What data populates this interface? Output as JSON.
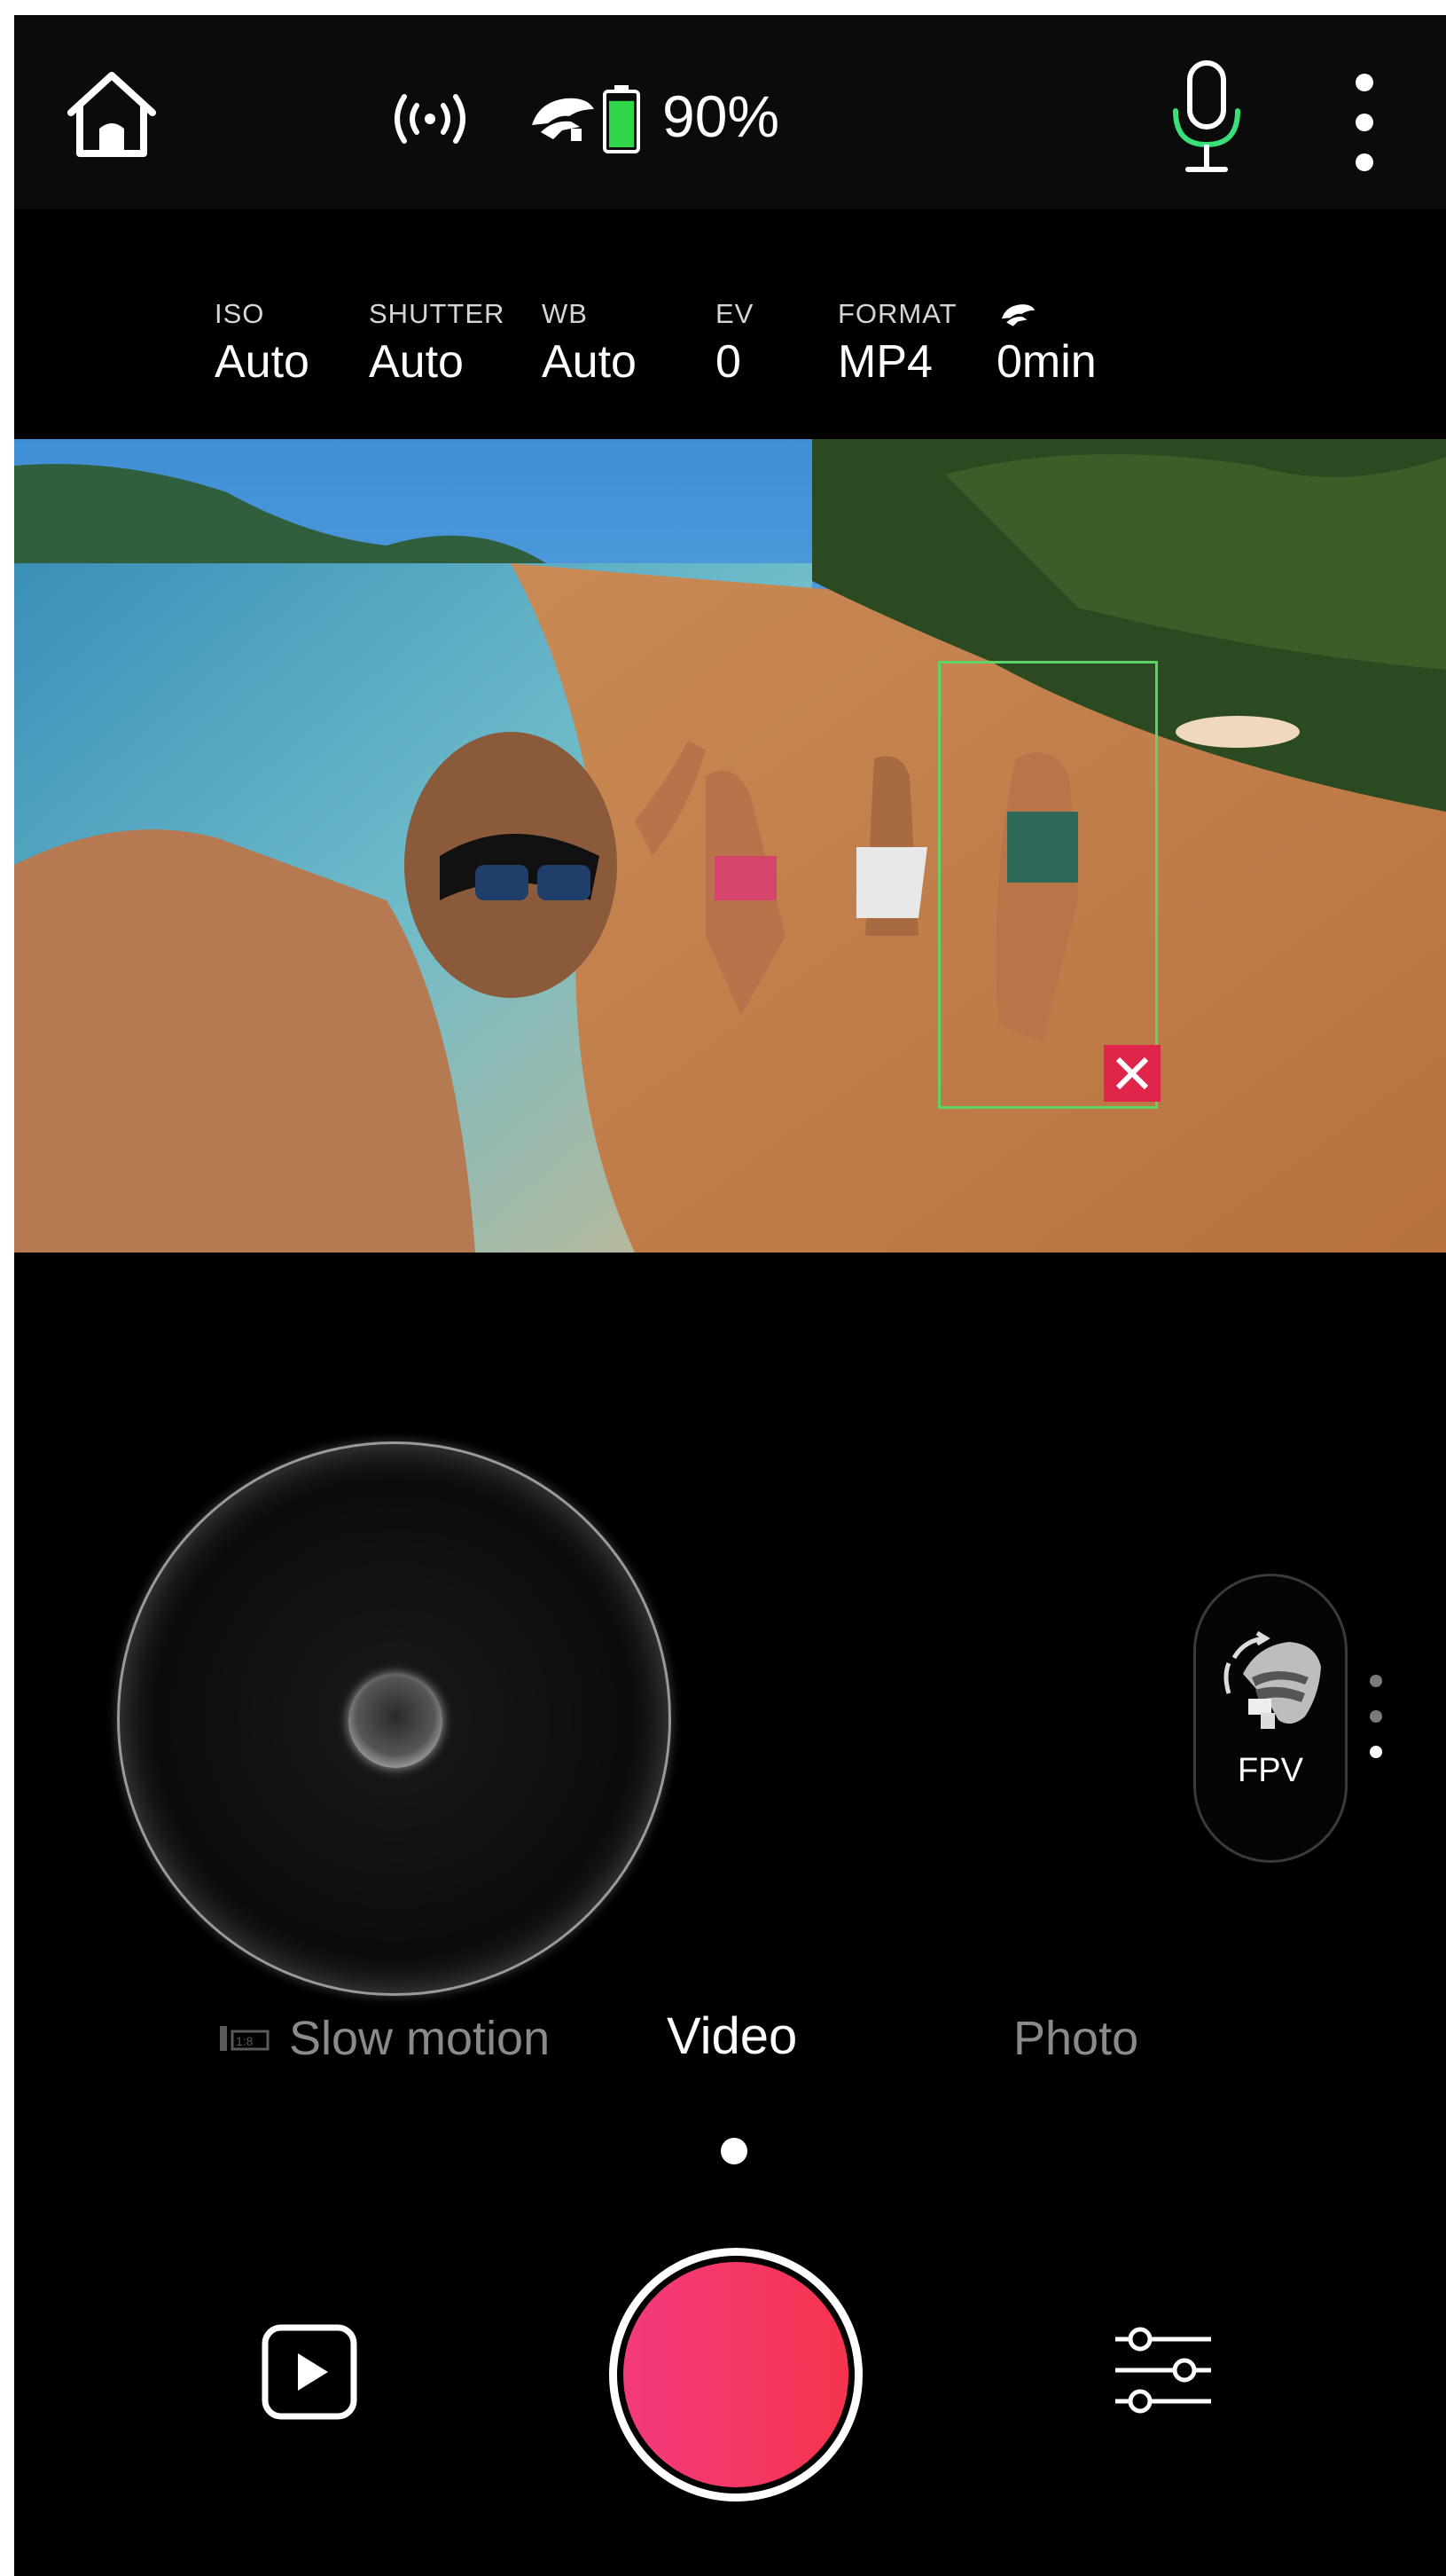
{
  "status": {
    "battery_percent": "90%",
    "battery_level": 0.9,
    "colors": {
      "battery_fill": "#2fd64a",
      "mic_accent": "#39e07a"
    }
  },
  "params": {
    "iso": {
      "label": "ISO",
      "value": "Auto"
    },
    "shutter": {
      "label": "SHUTTER",
      "value": "Auto"
    },
    "wb": {
      "label": "WB",
      "value": "Auto"
    },
    "ev": {
      "label": "EV",
      "value": "0"
    },
    "format": {
      "label": "FORMAT",
      "value": "MP4"
    },
    "remaining": {
      "icon": "gimbal-icon",
      "value": "0min"
    }
  },
  "preview": {
    "tracking_box_color": "#5fd36a",
    "tracking_close_color": "#e0254b"
  },
  "fpv": {
    "label": "FPV"
  },
  "modes": {
    "items": [
      {
        "label": "Slow motion",
        "selected": false
      },
      {
        "label": "Video",
        "selected": true
      },
      {
        "label": "Photo",
        "selected": false
      }
    ]
  },
  "shutter": {
    "colors": {
      "start": "#f33b7d",
      "end": "#f5344e"
    }
  }
}
